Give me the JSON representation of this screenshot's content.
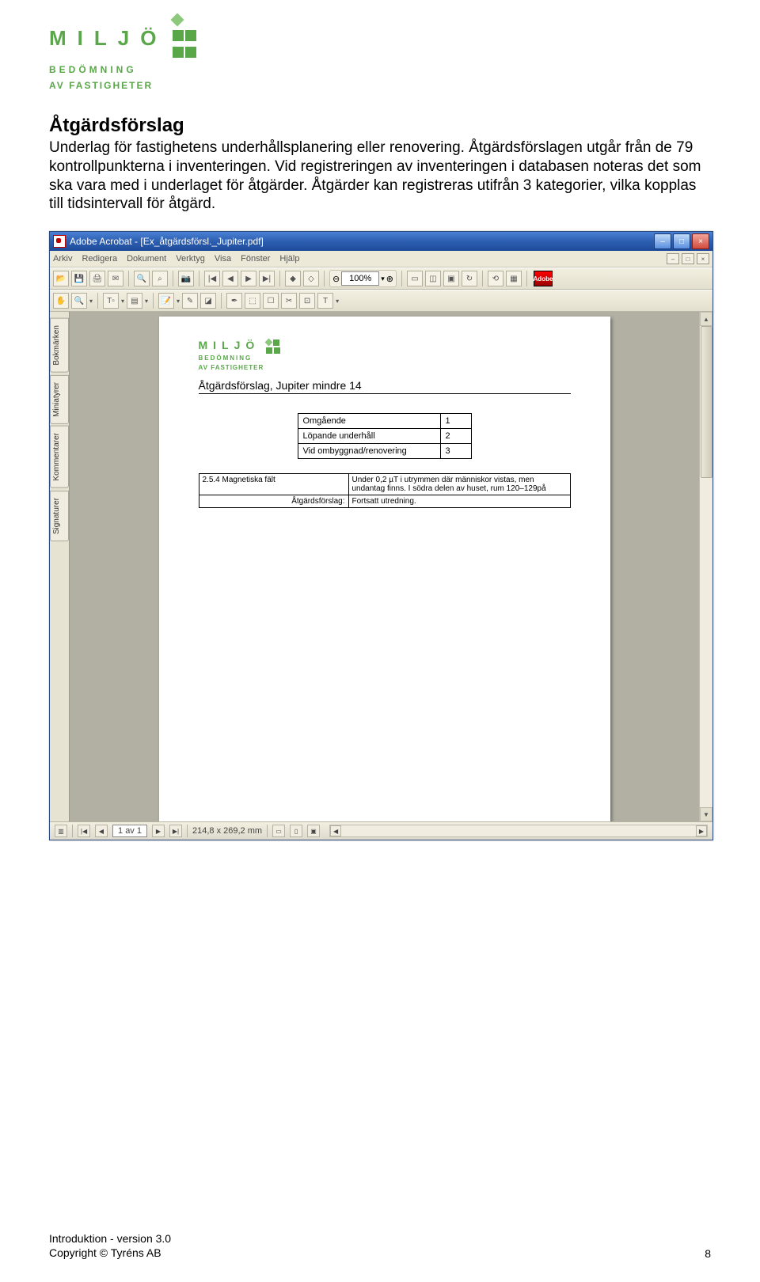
{
  "logo": {
    "line1": "MILJÖ",
    "line2": "BEDÖMNING",
    "line3": "AV FASTIGHETER"
  },
  "heading": "Åtgärdsförslag",
  "body": "Underlag för fastighetens underhållsplanering eller renovering. Åtgärdsförslagen utgår från de 79 kontrollpunkterna i inventeringen. Vid registreringen av inventeringen i databasen noteras det som ska vara med i underlaget för åtgärder. Åtgärder kan registreras utifrån 3 kategorier, vilka kopplas till tidsintervall för åtgärd.",
  "acrobat": {
    "title": "Adobe Acrobat - [Ex_åtgärdsförsl._Jupiter.pdf]",
    "menu": {
      "arkiv": "Arkiv",
      "redigera": "Redigera",
      "dokument": "Dokument",
      "verktyg": "Verktyg",
      "visa": "Visa",
      "fonster": "Fönster",
      "hjalp": "Hjälp"
    },
    "zoom": "100%",
    "adobe": "Adobe",
    "sidetabs": {
      "bokmarken": "Bokmärken",
      "miniatyrer": "Miniatyrer",
      "kommentarer": "Kommentarer",
      "signaturer": "Signaturer"
    },
    "doc": {
      "logo_line1": "MILJÖ",
      "logo_line2": "BEDÖMNING",
      "logo_line3": "AV FASTIGHETER",
      "title": "Åtgärdsförslag, Jupiter mindre 14",
      "categories": [
        {
          "label": "Omgående",
          "num": "1"
        },
        {
          "label": "Löpande underhåll",
          "num": "2"
        },
        {
          "label": "Vid ombyggnad/renovering",
          "num": "3"
        }
      ],
      "section": {
        "id": "2.5.4 Magnetiska fält",
        "desc": "Under 0,2 µT i utrymmen där människor vistas, men undantag finns. I södra delen av huset, rum 120–129på",
        "label": "Åtgärdsförslag:",
        "action": "Fortsatt utredning."
      }
    },
    "status": {
      "page": "1 av 1",
      "dim": "214,8 x 269,2 mm"
    }
  },
  "footer": {
    "line1": "Introduktion - version 3.0",
    "line2": "Copyright © Tyréns AB",
    "pagenum": "8"
  }
}
